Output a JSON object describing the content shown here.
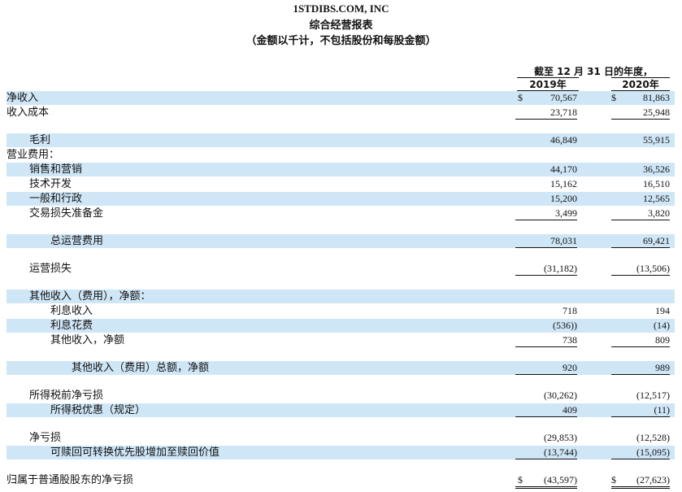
{
  "header": {
    "company": "1STDIBS.COM, INC",
    "title": "综合经营报表",
    "subtitle": "（金额以千计，不包括股份和每股金额）"
  },
  "columns": {
    "period": "截至 12 月 31 日的年度，",
    "year_a": "2019年",
    "year_b": "2020年"
  },
  "rows": [
    {
      "label": "净收入",
      "a": "70,567",
      "b": "81,863",
      "dollar": "$"
    },
    {
      "label": "收入成本",
      "a": "23,718",
      "b": "25,948"
    },
    {
      "label": "毛利",
      "a": "46,849",
      "b": "55,915"
    },
    {
      "label": "营业费用："
    },
    {
      "label": "销售和营销",
      "a": "44,170",
      "b": "36,526"
    },
    {
      "label": "技术开发",
      "a": "15,162",
      "b": "16,510"
    },
    {
      "label": "一般和行政",
      "a": "15,200",
      "b": "12,565"
    },
    {
      "label": "交易损失准备金",
      "a": "3,499",
      "b": "3,820"
    },
    {
      "label": "总运营费用",
      "a": "78,031",
      "b": "69,421"
    },
    {
      "label": "运营损失",
      "a": "(31,182)",
      "b": "(13,506)"
    },
    {
      "label": "其他收入（费用），净额："
    },
    {
      "label": "利息收入",
      "a": "718",
      "b": "194"
    },
    {
      "label": "利息花费",
      "a": "(536))",
      "b": "(14)"
    },
    {
      "label": "其他收入，净额",
      "a": "738",
      "b": "809"
    },
    {
      "label": "其他收入（费用）总额，净额",
      "a": "920",
      "b": "989"
    },
    {
      "label": "所得税前净亏损",
      "a": "(30,262)",
      "b": "(12,517)"
    },
    {
      "label": "所得税优惠（规定）",
      "a": "409",
      "b": "(11)"
    },
    {
      "label": "净亏损",
      "a": "(29,853)",
      "b": "(12,528)"
    },
    {
      "label": "可赎回可转换优先股增加至赎回价值",
      "a": "(13,744)",
      "b": "(15,095)"
    },
    {
      "label": "归属于普通股股东的净亏损",
      "a": "(43,597)",
      "b": "(27,623)",
      "dollar": "$"
    }
  ]
}
